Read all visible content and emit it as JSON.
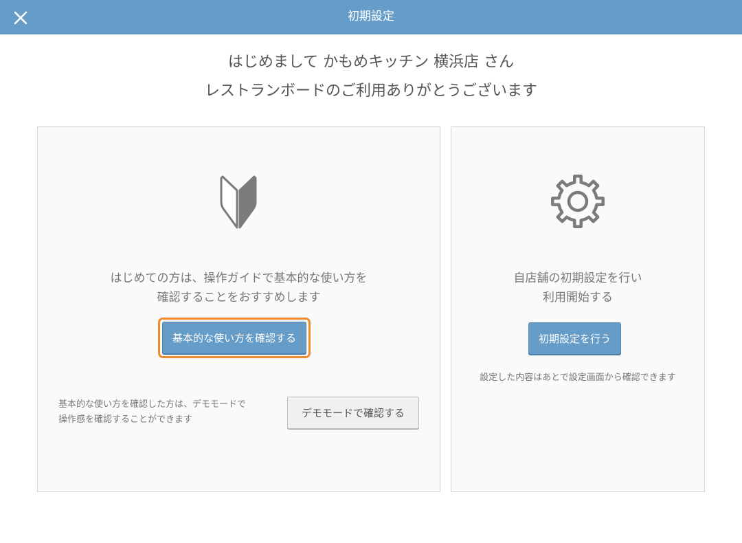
{
  "header": {
    "title": "初期設定",
    "close_icon": "close-icon"
  },
  "welcome": {
    "line1": "はじめまして かもめキッチン 横浜店 さん",
    "line2": "レストランボードのご利用ありがとうございます"
  },
  "guide_panel": {
    "icon": "beginner-mark-icon",
    "desc_line1": "はじめての方は、操作ガイドで基本的な使い方を",
    "desc_line2": "確認することをおすすめします",
    "button_label": "基本的な使い方を確認する",
    "demo_note_line1": "基本的な使い方を確認した方は、デモモードで",
    "demo_note_line2": "操作感を確認することができます",
    "demo_button_label": "デモモードで確認する"
  },
  "setup_panel": {
    "icon": "gear-icon",
    "desc_line1": "自店舗の初期設定を行い",
    "desc_line2": "利用開始する",
    "button_label": "初期設定を行う",
    "note": "設定した内容はあとで設定画面から確認できます"
  },
  "colors": {
    "header_bg": "#659cc8",
    "primary_button": "#659cc8",
    "focus_ring": "#f08a2c",
    "icon_gray": "#7b7b7b"
  }
}
